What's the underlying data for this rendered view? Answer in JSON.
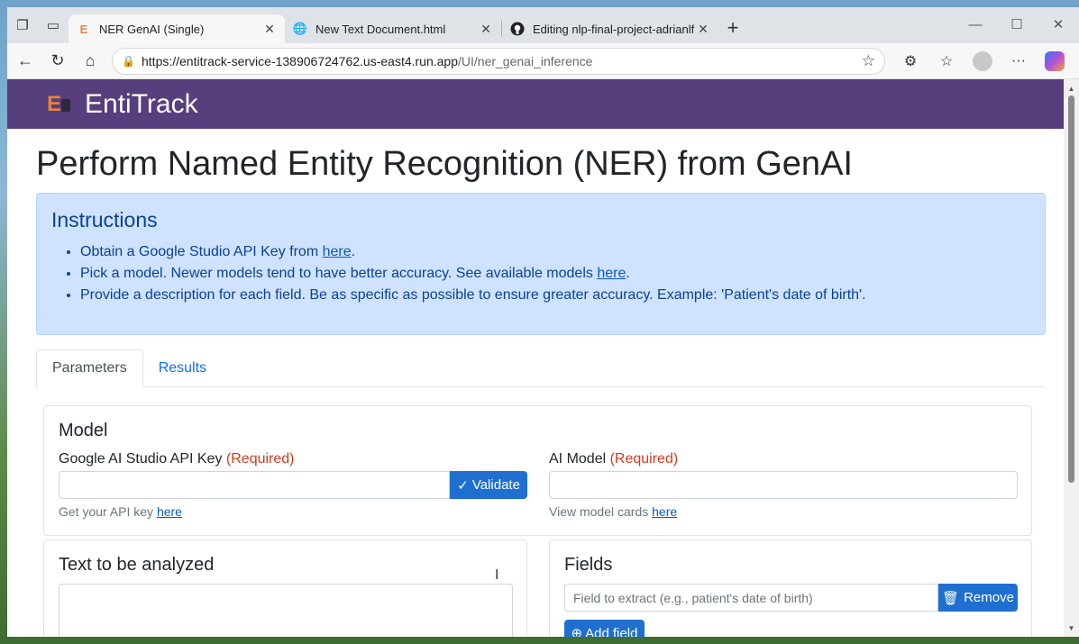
{
  "browser": {
    "tabs": [
      {
        "title": "NER GenAI (Single)",
        "favicon": "entitrack-favicon",
        "active": true
      },
      {
        "title": "New Text Document.html",
        "favicon": "globe-icon",
        "active": false
      },
      {
        "title": "Editing nlp-final-project-adrianlfm",
        "favicon": "github-icon",
        "active": false
      }
    ],
    "url_host": "https://entitrack-service-138906724762.us-east4.run.app",
    "url_path": "/UI/ner_genai_inference"
  },
  "brand": {
    "name": "EntiTrack",
    "logo_letter": "E"
  },
  "page": {
    "title": "Perform Named Entity Recognition (NER) from GenAI",
    "instructions": {
      "heading": "Instructions",
      "items": [
        {
          "text": "Obtain a Google Studio API Key from ",
          "link": "here",
          "after": "."
        },
        {
          "text": "Pick a model. Newer models tend to have better accuracy. See available models ",
          "link": "here",
          "after": "."
        },
        {
          "text": "Provide a description for each field. Be as specific as possible to ensure greater accuracy. Example: 'Patient's date of birth'.",
          "link": "",
          "after": ""
        }
      ]
    },
    "tabs": [
      "Parameters",
      "Results"
    ],
    "model_card": {
      "heading": "Model",
      "api_key_label": "Google AI Studio API Key",
      "required": "(Required)",
      "validate_label": "Validate",
      "api_help": "Get your API key ",
      "api_help_link": "here",
      "model_label": "AI Model",
      "model_help": "View model cards ",
      "model_help_link": "here"
    },
    "text_card": {
      "heading": "Text to be analyzed"
    },
    "fields_card": {
      "heading": "Fields",
      "field_placeholder": "Field to extract (e.g., patient's date of birth)",
      "remove_label": "Remove",
      "add_label": "Add field"
    }
  },
  "colors": {
    "brand_bar": "#573e7d",
    "accent": "#1f6fd1",
    "alert_bg": "#cfe2ff",
    "required": "#d63a1c"
  }
}
